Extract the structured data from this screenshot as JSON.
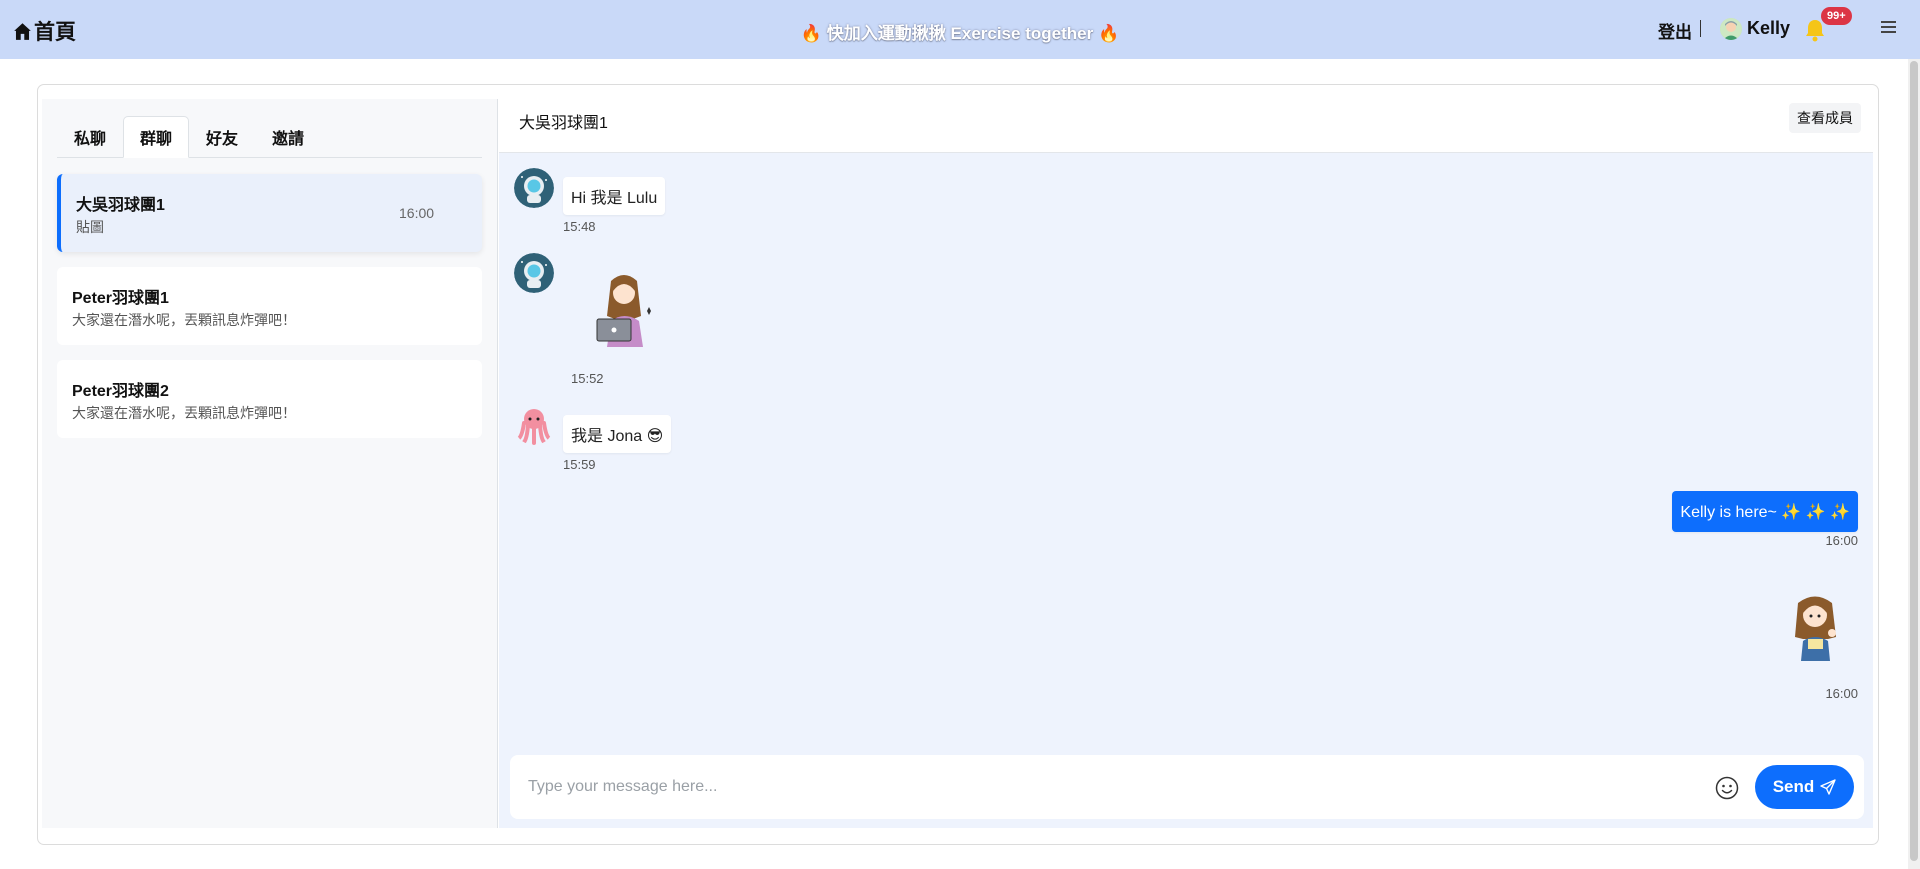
{
  "navbar": {
    "home_label": "首頁",
    "banner_text": "快加入運動揪揪 Exercise together",
    "logout_label": "登出",
    "username": "Kelly",
    "notification_count": "99+",
    "bg_color": "#c9d9f8",
    "icons": [
      "home-icon",
      "flame-icon",
      "user-avatar",
      "bell-icon",
      "menu-icon"
    ]
  },
  "tabs": [
    {
      "label": "私聊",
      "active": false
    },
    {
      "label": "群聊",
      "active": true
    },
    {
      "label": "好友",
      "active": false
    },
    {
      "label": "邀請",
      "active": false
    }
  ],
  "rooms": [
    {
      "name": "大吳羽球團1",
      "last_message": "貼圖",
      "time": "16:00",
      "active": true
    },
    {
      "name": "Peter羽球團1",
      "last_message": "大家還在潛水呢，丟顆訊息炸彈吧！",
      "time": "",
      "active": false
    },
    {
      "name": "Peter羽球團2",
      "last_message": "大家還在潛水呢，丟顆訊息炸彈吧！",
      "time": "",
      "active": false
    }
  ],
  "chat": {
    "title": "大吳羽球團1",
    "members_button": "查看成員",
    "messages": [
      {
        "sender": "Lulu",
        "type": "text",
        "text": "Hi 我是 Lulu",
        "time": "15:48",
        "mine": false,
        "avatar": "astronaut-avatar"
      },
      {
        "sender": "Lulu",
        "type": "sticker",
        "sticker": "girl-laptop-sticker",
        "time": "15:52",
        "mine": false,
        "avatar": "astronaut-avatar"
      },
      {
        "sender": "Jona",
        "type": "text",
        "text": "我是 Jona 😎",
        "time": "15:59",
        "mine": false,
        "avatar": "octopus-avatar"
      },
      {
        "sender": "Kelly",
        "type": "text",
        "text": "Kelly is here~ ✨ ✨ ✨",
        "time": "16:00",
        "mine": true
      },
      {
        "sender": "Kelly",
        "type": "sticker",
        "sticker": "girl-thumbs-up-sticker",
        "time": "16:00",
        "mine": true
      }
    ]
  },
  "composer": {
    "placeholder": "Type your message here...",
    "value": "",
    "send_label": "Send",
    "accent_color": "#0d6efd"
  }
}
